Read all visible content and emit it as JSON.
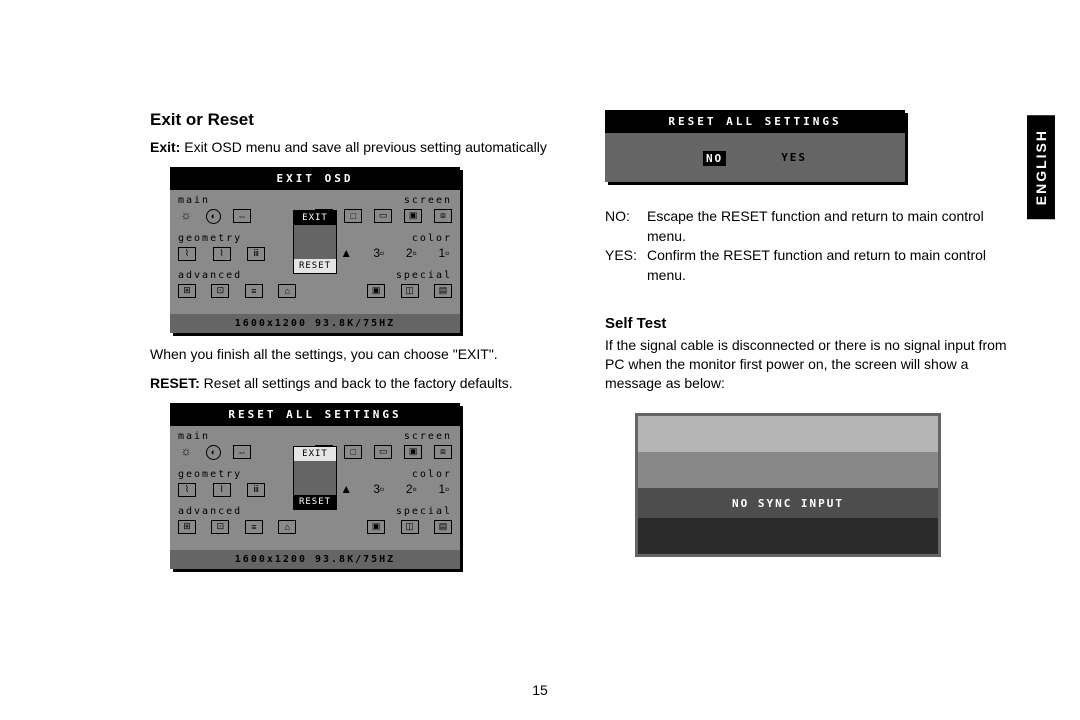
{
  "lang_tab": "ENGLISH",
  "page_number": "15",
  "left": {
    "heading": "Exit or Reset",
    "exit_label": "Exit:",
    "exit_text": " Exit OSD menu and save all previous setting automatically",
    "after_exit": "When you finish all the settings, you can choose \"EXIT\".",
    "reset_label": "RESET:",
    "reset_text": " Reset all settings and back to the factory defaults."
  },
  "right": {
    "no_label": "NO:",
    "no_text": "Escape the RESET function and return to main control menu.",
    "yes_label": "YES:",
    "yes_text": "Confirm the RESET function and return to main control menu.",
    "selftest_heading": "Self Test",
    "selftest_text": "If the signal cable is disconnected or there is no signal input from PC when the monitor first power on, the screen will show a message as below:"
  },
  "osd_common": {
    "tab_main": "main",
    "tab_screen": "screen",
    "tab_geometry": "geometry",
    "tab_color": "color",
    "tab_advanced": "advanced",
    "tab_special": "special",
    "btn_exit": "EXIT",
    "btn_reset": "RESET",
    "footer": "1600x1200 93.8K/75HZ"
  },
  "osd1_title": "EXIT OSD",
  "osd2_title": "RESET ALL SETTINGS",
  "reset_dialog": {
    "title": "RESET ALL SETTINGS",
    "no": "NO",
    "yes": "YES"
  },
  "nosync_text": "NO SYNC INPUT"
}
